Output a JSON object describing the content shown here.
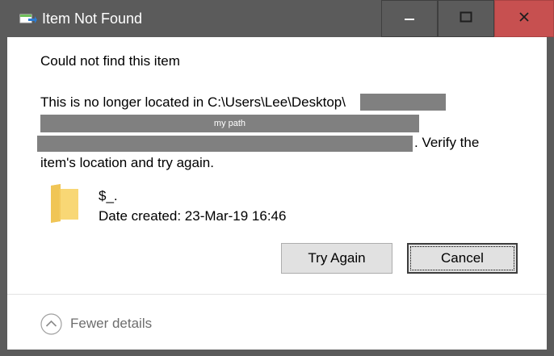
{
  "window": {
    "title": "Item Not Found",
    "min_icon": "minimize-icon",
    "max_icon": "maximize-icon",
    "close_icon": "close-icon",
    "close_color": "#c75050",
    "titlebar_color": "#5b5b5b"
  },
  "message": {
    "heading": "Could not find this item",
    "line1": "This is no longer located in C:\\Users\\Lee\\Desktop\\",
    "redacted_label": "my path",
    "line3": ". Verify the",
    "line4": "item's location and try again."
  },
  "item": {
    "icon": "folder-icon",
    "name": "$_.",
    "date_created": "Date created: 23-Mar-19 16:46"
  },
  "buttons": {
    "try_again": "Try Again",
    "cancel": "Cancel"
  },
  "details_toggle": {
    "label": "Fewer details",
    "icon": "chevron-up-icon"
  }
}
